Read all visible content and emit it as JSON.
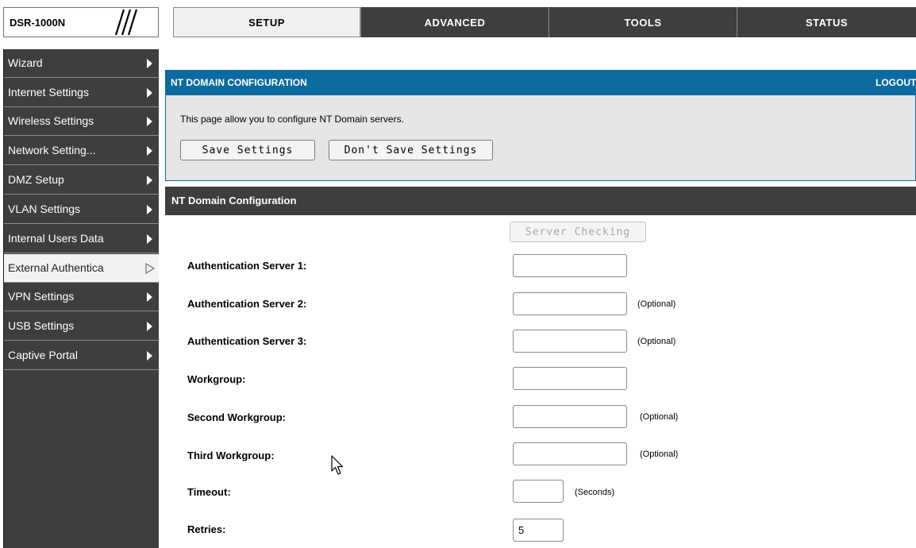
{
  "header": {
    "model": "DSR-1000N",
    "tabs": [
      {
        "label": "SETUP",
        "active": true
      },
      {
        "label": "ADVANCED",
        "active": false
      },
      {
        "label": "TOOLS",
        "active": false
      },
      {
        "label": "STATUS",
        "active": false
      }
    ]
  },
  "sidebar": {
    "items": [
      {
        "label": "Wizard",
        "icon": "arrow-right-icon"
      },
      {
        "label": "Internet Settings",
        "icon": "arrow-right-icon"
      },
      {
        "label": "Wireless Settings",
        "icon": "arrow-right-icon"
      },
      {
        "label": "Network Setting...",
        "icon": "arrow-right-icon"
      },
      {
        "label": "DMZ Setup",
        "icon": "arrow-right-icon"
      },
      {
        "label": "VLAN Settings",
        "icon": "arrow-right-icon"
      },
      {
        "label": "Internal Users Data",
        "icon": "arrow-right-icon"
      },
      {
        "label": "External Authentica",
        "icon": "arrow-right-outline-icon",
        "selected": true
      },
      {
        "label": "VPN Settings",
        "icon": "arrow-right-icon"
      },
      {
        "label": "USB Settings",
        "icon": "arrow-right-icon"
      },
      {
        "label": "Captive Portal",
        "icon": "arrow-right-icon"
      }
    ]
  },
  "page": {
    "title": "NT DOMAIN CONFIGURATION",
    "logout": "LOGOUT",
    "intro": "This page allow you to configure NT Domain servers.",
    "save_button": "Save Settings",
    "dont_save_button": "Don't Save Settings"
  },
  "section": {
    "title": "NT Domain Configuration",
    "server_checking_button": "Server Checking",
    "fields": [
      {
        "label": "Authentication Server 1:",
        "value": "",
        "hint": ""
      },
      {
        "label": "Authentication Server 2:",
        "value": "",
        "hint": "(Optional)"
      },
      {
        "label": "Authentication Server 3:",
        "value": "",
        "hint": "(Optional)"
      },
      {
        "label": "Workgroup:",
        "value": "",
        "hint": ""
      },
      {
        "label": "Second Workgroup:",
        "value": "",
        "hint": "(Optional)"
      },
      {
        "label": "Third Workgroup:",
        "value": "",
        "hint": "(Optional)"
      },
      {
        "label": "Timeout:",
        "value": "",
        "hint": "(Seconds)"
      },
      {
        "label": "Retries:",
        "value": "5",
        "hint": ""
      }
    ]
  },
  "colors": {
    "blue_header": "#0b6b9f",
    "dark_gray": "#3e3e3e",
    "panel_gray": "#e6e6e6"
  }
}
